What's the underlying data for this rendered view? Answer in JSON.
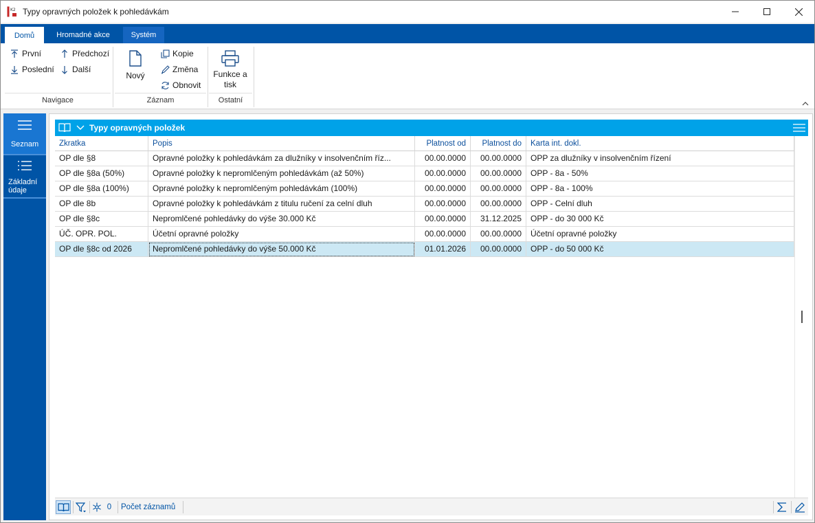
{
  "window": {
    "title": "Typy opravných položek k pohledávkám"
  },
  "tabs": [
    {
      "label": "Domů"
    },
    {
      "label": "Hromadné akce"
    },
    {
      "label": "Systém"
    }
  ],
  "ribbon": {
    "navigation": {
      "first": "První",
      "previous": "Předchozí",
      "last": "Poslední",
      "next": "Další",
      "group_label": "Navigace"
    },
    "record": {
      "new": "Nový",
      "copy": "Kopie",
      "change": "Změna",
      "refresh": "Obnovit",
      "group_label": "Záznam"
    },
    "other": {
      "functions_line1": "Funkce a",
      "functions_line2": "tisk",
      "group_label": "Ostatní"
    }
  },
  "leftnav": {
    "list": "Seznam",
    "basic_line1": "Základní",
    "basic_line2": "údaje"
  },
  "grid": {
    "title": "Typy opravných položek",
    "columns": [
      "Zkratka",
      "Popis",
      "Platnost od",
      "Platnost do",
      "Karta int. dokl."
    ],
    "rows": [
      [
        "OP dle §8",
        "Opravné položky k pohledávkám za dlužníky v insolvenčním říz...",
        "00.00.0000",
        "00.00.0000",
        "OPP za dlužníky v insolvenčním řízení"
      ],
      [
        "OP dle §8a (50%)",
        "Opravné položky k nepromlčeným pohledávkám (až 50%)",
        "00.00.0000",
        "00.00.0000",
        "OPP - 8a - 50%"
      ],
      [
        "OP dle §8a (100%)",
        "Opravné položky k nepromlčeným pohledávkám (100%)",
        "00.00.0000",
        "00.00.0000",
        "OPP - 8a - 100%"
      ],
      [
        "OP dle 8b",
        "Opravné položky k pohledávkám z titulu ručení za celní dluh",
        "00.00.0000",
        "00.00.0000",
        "OPP - Celní dluh"
      ],
      [
        "OP dle §8c",
        "Nepromlčené pohledávky do výše 30.000 Kč",
        "00.00.0000",
        "31.12.2025",
        "OPP - do 30 000 Kč"
      ],
      [
        "ÚČ. OPR. POL.",
        "Účetní opravné položky",
        "00.00.0000",
        "00.00.0000",
        "Účetní opravné položky"
      ],
      [
        "OP dle §8c od 2026",
        "Nepromlčené pohledávky do výše 50.000 Kč",
        "01.01.2026",
        "00.00.0000",
        "OPP - do 50 000 Kč"
      ]
    ],
    "selected_row": 6
  },
  "footer": {
    "frozen_count": "0",
    "record_count_label": "Počet záznamů"
  },
  "colors": {
    "ribbon_blue": "#0054a6",
    "grid_header": "#00a2e8",
    "selection": "#cce8f4",
    "column_text": "#0b4f9c"
  }
}
